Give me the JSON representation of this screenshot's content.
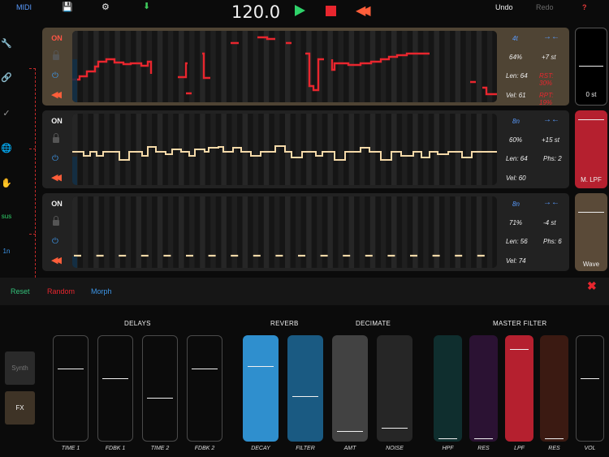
{
  "topbar": {
    "midi_label": "MIDI",
    "save_icon": "save-icon",
    "settings_icon": "gear-icon",
    "download_icon": "download-icon",
    "tempo": "120.0",
    "undo_label": "Undo",
    "redo_label": "Redo",
    "help_label": "?"
  },
  "sidebar": {
    "sus_label": "sus",
    "rate_label": "1n"
  },
  "tracks": [
    {
      "on_label": "ON",
      "division": "4t",
      "swing": "64%",
      "transpose": "+7 st",
      "length": "Len: 64",
      "param2": "RST: 30%",
      "velocity": "Vel: 61",
      "param3": "RPT: 19%"
    },
    {
      "on_label": "ON",
      "division": "8n",
      "swing": "60%",
      "transpose": "+15 st",
      "length": "Len: 64",
      "param2": "Phs: 2",
      "velocity": "Vel: 60",
      "param3": ""
    },
    {
      "on_label": "ON",
      "division": "8n",
      "swing": "71%",
      "transpose": "-4 st",
      "length": "Len: 56",
      "param2": "Phs: 6",
      "velocity": "Vel: 74",
      "param3": ""
    }
  ],
  "right_faders": {
    "pitch_label": "0 st",
    "lpf_label": "M. LPF",
    "wave_label": "Wave"
  },
  "actions": {
    "reset_label": "Reset",
    "random_label": "Random",
    "morph_label": "Morph"
  },
  "modes": {
    "synth_label": "Synth",
    "fx_label": "FX"
  },
  "groups": {
    "delays": "DELAYS",
    "reverb": "REVERB",
    "decimate": "DECIMATE",
    "master_filter": "MASTER FILTER"
  },
  "sliders": [
    {
      "label": "TIME 1",
      "value": 0.68
    },
    {
      "label": "FDBK 1",
      "value": 0.59
    },
    {
      "label": "TIME 2",
      "value": 0.4
    },
    {
      "label": "FDBK 2",
      "value": 0.68
    },
    {
      "label": "DECAY",
      "value": 0.71
    },
    {
      "label": "FILTER",
      "value": 0.41
    },
    {
      "label": "AMT",
      "value": 0.07
    },
    {
      "label": "NOISE",
      "value": 0.1
    },
    {
      "label": "HPF",
      "value": 0.0
    },
    {
      "label": "RES",
      "value": 0.0
    },
    {
      "label": "LPF",
      "value": 0.87
    },
    {
      "label": "RES",
      "value": 0.0
    },
    {
      "label": "VOL",
      "value": 0.59
    }
  ],
  "colors": {
    "accent_red": "#e8262e",
    "accent_blue": "#3d96e8",
    "accent_green": "#2fd26a",
    "cream_line": "#f4d9a8",
    "track_active_bg": "#4f4434",
    "reverb_blue": "#2f8fce"
  }
}
